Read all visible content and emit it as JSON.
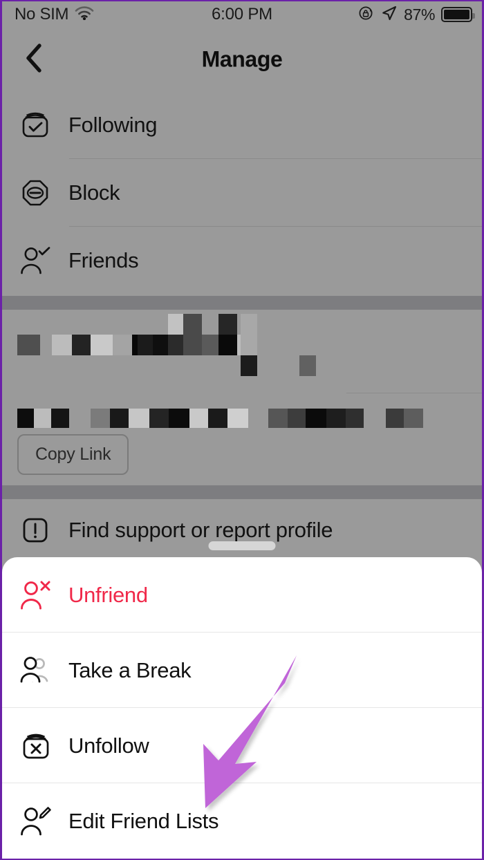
{
  "status_bar": {
    "carrier": "No SIM",
    "wifi_icon": "wifi-icon",
    "time": "6:00 PM",
    "rotation_lock_icon": "rotation-lock-icon",
    "location_icon": "location-arrow-icon",
    "battery_percent": "87%",
    "battery_icon": "battery-full-icon"
  },
  "nav": {
    "back_icon": "chevron-left-icon",
    "title": "Manage"
  },
  "manage_section": {
    "items": [
      {
        "label": "Following",
        "icon": "box-check-icon"
      },
      {
        "label": "Block",
        "icon": "octagon-minus-icon"
      },
      {
        "label": "Friends",
        "icon": "person-check-icon"
      }
    ]
  },
  "redacted_section": {
    "note": "blurred profile details",
    "copy_link_label": "Copy Link"
  },
  "support_section": {
    "items": [
      {
        "label": "Find support or report profile",
        "icon": "exclamation-square-icon"
      }
    ]
  },
  "bottom_sheet": {
    "drag_handle": "drag-handle",
    "items": [
      {
        "label": "Unfriend",
        "icon": "person-x-icon",
        "danger": true
      },
      {
        "label": "Take a Break",
        "icon": "two-people-icon",
        "danger": false
      },
      {
        "label": "Unfollow",
        "icon": "box-x-icon",
        "danger": false
      },
      {
        "label": "Edit Friend Lists",
        "icon": "person-pencil-icon",
        "danger": false
      }
    ]
  },
  "annotation": {
    "arrow_icon": "purple-arrow-annotation",
    "color": "#c065d8",
    "points_to": "Edit Friend Lists"
  },
  "colors": {
    "dimmed_background": "#9a9a9a",
    "band": "#7d7d80",
    "sheet_background": "#ffffff",
    "danger": "#f02849",
    "annotation_purple": "#c065d8",
    "screenshot_border": "#6b21a8"
  }
}
